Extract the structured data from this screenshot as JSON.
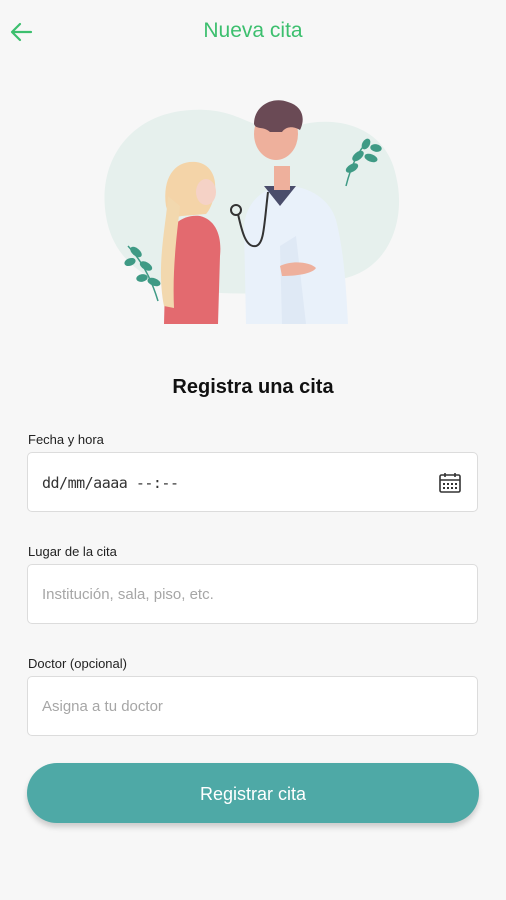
{
  "header": {
    "title": "Nueva cita",
    "back_icon": "arrow-left-icon",
    "accent_color": "#3cbf6e"
  },
  "illustration": {
    "icon": "doctor-patient-illustration"
  },
  "form": {
    "heading": "Registra una cita",
    "fecha": {
      "label": "Fecha y hora",
      "value": "dd/mm/aaaa --:--",
      "icon": "calendar-icon"
    },
    "lugar": {
      "label": "Lugar de la cita",
      "placeholder": "Institución, sala, piso, etc."
    },
    "doctor": {
      "label": "Doctor (opcional)",
      "placeholder": "Asigna a tu doctor"
    },
    "submit_label": "Registrar cita",
    "button_color": "#4ea9a6"
  }
}
